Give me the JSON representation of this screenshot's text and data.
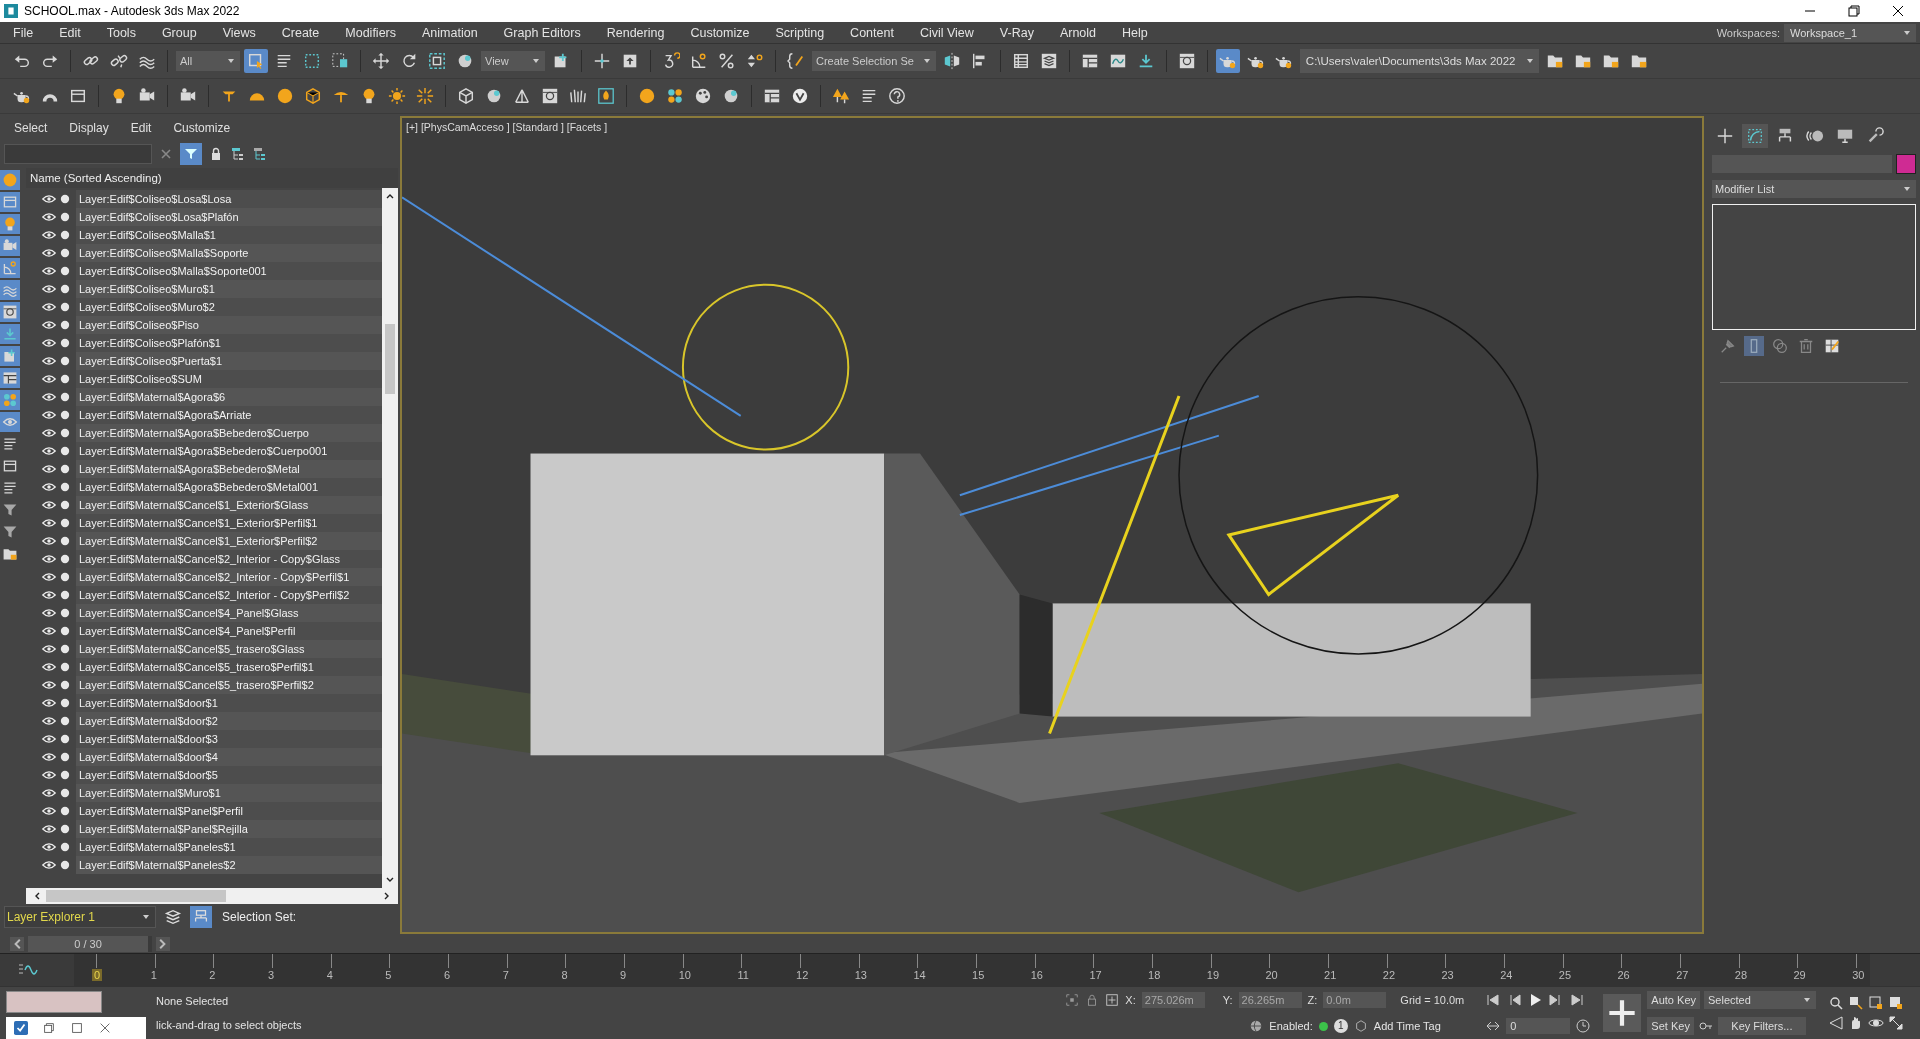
{
  "window": {
    "title": "SCHOOL.max - Autodesk 3ds Max 2022"
  },
  "menu_bar": [
    "File",
    "Edit",
    "Tools",
    "Group",
    "Views",
    "Create",
    "Modifiers",
    "Animation",
    "Graph Editors",
    "Rendering",
    "Customize",
    "Scripting",
    "Content",
    "Civil View",
    "V-Ray",
    "Arnold",
    "Help"
  ],
  "workspaces": {
    "label": "Workspaces:",
    "value": "Workspace_1"
  },
  "toolbar_1": [
    {
      "kind": "undo",
      "on": false
    },
    {
      "kind": "redo",
      "on": false
    },
    {
      "kind": "sep"
    },
    {
      "kind": "link",
      "on": false
    },
    {
      "kind": "unlink",
      "on": false
    },
    {
      "kind": "wave",
      "on": false
    },
    {
      "kind": "sep"
    },
    {
      "kind": "dropdown",
      "value": "All"
    },
    {
      "kind": "select",
      "on": true
    },
    {
      "kind": "list",
      "on": false
    },
    {
      "kind": "rect",
      "on": false
    },
    {
      "kind": "crossing",
      "on": false
    },
    {
      "kind": "sep"
    },
    {
      "kind": "move",
      "on": false
    },
    {
      "kind": "rotate",
      "on": false
    },
    {
      "kind": "scale",
      "on": false
    },
    {
      "kind": "sphere",
      "on": false
    },
    {
      "kind": "dropdown",
      "value": "View"
    },
    {
      "kind": "pivot",
      "on": false
    },
    {
      "kind": "sep"
    },
    {
      "kind": "cross",
      "on": false
    },
    {
      "kind": "upload",
      "on": false
    },
    {
      "kind": "sep"
    },
    {
      "kind": "snap",
      "on": false
    },
    {
      "kind": "angle",
      "on": false
    },
    {
      "kind": "percent",
      "on": false
    },
    {
      "kind": "spinner",
      "on": false
    },
    {
      "kind": "sep"
    },
    {
      "kind": "brace",
      "on": false
    },
    {
      "kind": "dropdown",
      "value": "Create Selection Se"
    },
    {
      "kind": "mirror",
      "on": false
    },
    {
      "kind": "align",
      "on": false
    },
    {
      "kind": "sep"
    },
    {
      "kind": "table",
      "on": false
    },
    {
      "kind": "layers",
      "on": false
    },
    {
      "kind": "sep"
    },
    {
      "kind": "panels",
      "on": false
    },
    {
      "kind": "curve",
      "on": false
    },
    {
      "kind": "download",
      "on": false
    },
    {
      "kind": "sep"
    },
    {
      "kind": "grid",
      "on": false
    },
    {
      "kind": "sep"
    },
    {
      "kind": "teapot",
      "on": true
    },
    {
      "kind": "teapot",
      "on": false
    },
    {
      "kind": "teapot",
      "on": false
    },
    {
      "kind": "path",
      "value": "C:\\Users\\valer\\Documents\\3ds Max 2022"
    },
    {
      "kind": "folder",
      "on": false
    },
    {
      "kind": "folder",
      "on": false
    },
    {
      "kind": "folder",
      "on": false
    },
    {
      "kind": "folder",
      "on": false
    }
  ],
  "toolbar_2": [
    {
      "kind": "teapot",
      "on": false
    },
    {
      "kind": "dome",
      "on": false
    },
    {
      "kind": "box",
      "on": false
    },
    {
      "kind": "sep"
    },
    {
      "kind": "bulb",
      "on": false
    },
    {
      "kind": "camera",
      "on": false
    },
    {
      "kind": "sep"
    },
    {
      "kind": "camera",
      "on": false
    },
    {
      "kind": "sep"
    },
    {
      "kind": "spot",
      "on": false
    },
    {
      "kind": "half",
      "on": false
    },
    {
      "kind": "ball",
      "on": false
    },
    {
      "kind": "gem",
      "on": false
    },
    {
      "kind": "umbrella",
      "on": false
    },
    {
      "kind": "bulb",
      "on": false
    },
    {
      "kind": "sun",
      "on": false
    },
    {
      "kind": "burst",
      "on": false
    },
    {
      "kind": "sep"
    },
    {
      "kind": "cube",
      "on": false
    },
    {
      "kind": "sphere",
      "on": false
    },
    {
      "kind": "tripod",
      "on": false
    },
    {
      "kind": "grid",
      "on": false
    },
    {
      "kind": "grass",
      "on": false
    },
    {
      "kind": "flame",
      "on": false
    },
    {
      "kind": "sep"
    },
    {
      "kind": "ball",
      "on": false
    },
    {
      "kind": "dots",
      "on": false
    },
    {
      "kind": "palette",
      "on": false
    },
    {
      "kind": "sphere",
      "on": false
    },
    {
      "kind": "sep"
    },
    {
      "kind": "panels",
      "on": false
    },
    {
      "kind": "vlogo",
      "on": false
    },
    {
      "kind": "sep"
    },
    {
      "kind": "tree",
      "on": false
    },
    {
      "kind": "list",
      "on": false
    },
    {
      "kind": "help",
      "on": false
    }
  ],
  "scene_explorer": {
    "menu": [
      "Select",
      "Display",
      "Edit",
      "Customize"
    ],
    "side_toolbar": [
      {
        "kind": "ball",
        "on": true
      },
      {
        "kind": "box",
        "on": true
      },
      {
        "kind": "bulb",
        "on": true
      },
      {
        "kind": "camera",
        "on": true
      },
      {
        "kind": "angle",
        "on": true
      },
      {
        "kind": "wave",
        "on": true
      },
      {
        "kind": "grid",
        "on": true
      },
      {
        "kind": "download",
        "on": true
      },
      {
        "kind": "pivot",
        "on": true
      },
      {
        "kind": "panels",
        "on": true
      },
      {
        "kind": "dots",
        "on": true
      },
      {
        "kind": "eye",
        "on": true
      },
      {
        "kind": "list",
        "on": false
      },
      {
        "kind": "box",
        "on": false
      },
      {
        "kind": "list",
        "on": false
      },
      {
        "kind": "filter",
        "on": false
      },
      {
        "kind": "filter",
        "on": false
      },
      {
        "kind": "folder",
        "on": false
      }
    ],
    "column_header": "Name (Sorted Ascending)",
    "layers": [
      {
        "name": "Layer:Edif$Coliseo$Losa$Losa"
      },
      {
        "name": "Layer:Edif$Coliseo$Losa$Plafón"
      },
      {
        "name": "Layer:Edif$Coliseo$Malla$1"
      },
      {
        "name": "Layer:Edif$Coliseo$Malla$Soporte"
      },
      {
        "name": "Layer:Edif$Coliseo$Malla$Soporte001"
      },
      {
        "name": "Layer:Edif$Coliseo$Muro$1"
      },
      {
        "name": "Layer:Edif$Coliseo$Muro$2"
      },
      {
        "name": "Layer:Edif$Coliseo$Piso"
      },
      {
        "name": "Layer:Edif$Coliseo$Plafón$1"
      },
      {
        "name": "Layer:Edif$Coliseo$Puerta$1"
      },
      {
        "name": "Layer:Edif$Coliseo$SUM"
      },
      {
        "name": "Layer:Edif$Maternal$Agora$6"
      },
      {
        "name": "Layer:Edif$Maternal$Agora$Arriate"
      },
      {
        "name": "Layer:Edif$Maternal$Agora$Bebedero$Cuerpo"
      },
      {
        "name": "Layer:Edif$Maternal$Agora$Bebedero$Cuerpo001"
      },
      {
        "name": "Layer:Edif$Maternal$Agora$Bebedero$Metal"
      },
      {
        "name": "Layer:Edif$Maternal$Agora$Bebedero$Metal001"
      },
      {
        "name": "Layer:Edif$Maternal$Cancel$1_Exterior$Glass"
      },
      {
        "name": "Layer:Edif$Maternal$Cancel$1_Exterior$Perfil$1"
      },
      {
        "name": "Layer:Edif$Maternal$Cancel$1_Exterior$Perfil$2"
      },
      {
        "name": "Layer:Edif$Maternal$Cancel$2_Interior - Copy$Glass"
      },
      {
        "name": "Layer:Edif$Maternal$Cancel$2_Interior - Copy$Perfil$1"
      },
      {
        "name": "Layer:Edif$Maternal$Cancel$2_Interior - Copy$Perfil$2"
      },
      {
        "name": "Layer:Edif$Maternal$Cancel$4_Panel$Glass"
      },
      {
        "name": "Layer:Edif$Maternal$Cancel$4_Panel$Perfil"
      },
      {
        "name": "Layer:Edif$Maternal$Cancel$5_trasero$Glass"
      },
      {
        "name": "Layer:Edif$Maternal$Cancel$5_trasero$Perfil$1"
      },
      {
        "name": "Layer:Edif$Maternal$Cancel$5_trasero$Perfil$2"
      },
      {
        "name": "Layer:Edif$Maternal$door$1"
      },
      {
        "name": "Layer:Edif$Maternal$door$2"
      },
      {
        "name": "Layer:Edif$Maternal$door$3"
      },
      {
        "name": "Layer:Edif$Maternal$door$4"
      },
      {
        "name": "Layer:Edif$Maternal$door$5"
      },
      {
        "name": "Layer:Edif$Maternal$Muro$1"
      },
      {
        "name": "Layer:Edif$Maternal$Panel$Perfil"
      },
      {
        "name": "Layer:Edif$Maternal$Panel$Rejilla"
      },
      {
        "name": "Layer:Edif$Maternal$Paneles$1"
      },
      {
        "name": "Layer:Edif$Maternal$Paneles$2"
      }
    ],
    "explorer_name": "Layer Explorer 1",
    "selection_set_label": "Selection Set:"
  },
  "viewport": {
    "label": "[+] [PhysCamAcceso ] [Standard ] [Facets ]"
  },
  "command_panel": {
    "tabs": [
      {
        "kind": "plus",
        "selected": false
      },
      {
        "kind": "modify",
        "selected": true
      },
      {
        "kind": "hierarchy",
        "selected": false
      },
      {
        "kind": "motion",
        "selected": false
      },
      {
        "kind": "display",
        "selected": false
      },
      {
        "kind": "wrench",
        "selected": false
      }
    ],
    "modifier_list": "Modifier List",
    "stack_buttons": [
      {
        "kind": "pin",
        "on": false
      },
      {
        "kind": "bar",
        "on": true
      },
      {
        "kind": "unique",
        "on": false
      },
      {
        "kind": "trash",
        "on": false
      },
      {
        "kind": "config",
        "on": false
      }
    ]
  },
  "time_slider": {
    "label": "0 / 30",
    "level": 0
  },
  "timeline": {
    "frames": [
      "0",
      "1",
      "2",
      "3",
      "4",
      "5",
      "6",
      "7",
      "8",
      "9",
      "10",
      "11",
      "12",
      "13",
      "14",
      "15",
      "16",
      "17",
      "18",
      "19",
      "20",
      "21",
      "22",
      "23",
      "24",
      "25",
      "26",
      "27",
      "28",
      "29",
      "30"
    ]
  },
  "status_bar": {
    "selection": "None Selected",
    "prompt": "lick-and-drag to select objects",
    "coords": [
      {
        "label": "X:",
        "value": "275.026m"
      },
      {
        "label": "Y:",
        "value": "26.265m"
      },
      {
        "label": "Z:",
        "value": "0.0m"
      }
    ],
    "grid": "Grid = 10.0m",
    "enabled_label": "Enabled:",
    "enabled": true,
    "badge": "1",
    "time_tag": "Add Time Tag",
    "auto_key": "Auto Key",
    "key_mode": "Selected",
    "set_key": "Set Key",
    "key_filters": "Key Filters...",
    "current_frame": "0"
  }
}
